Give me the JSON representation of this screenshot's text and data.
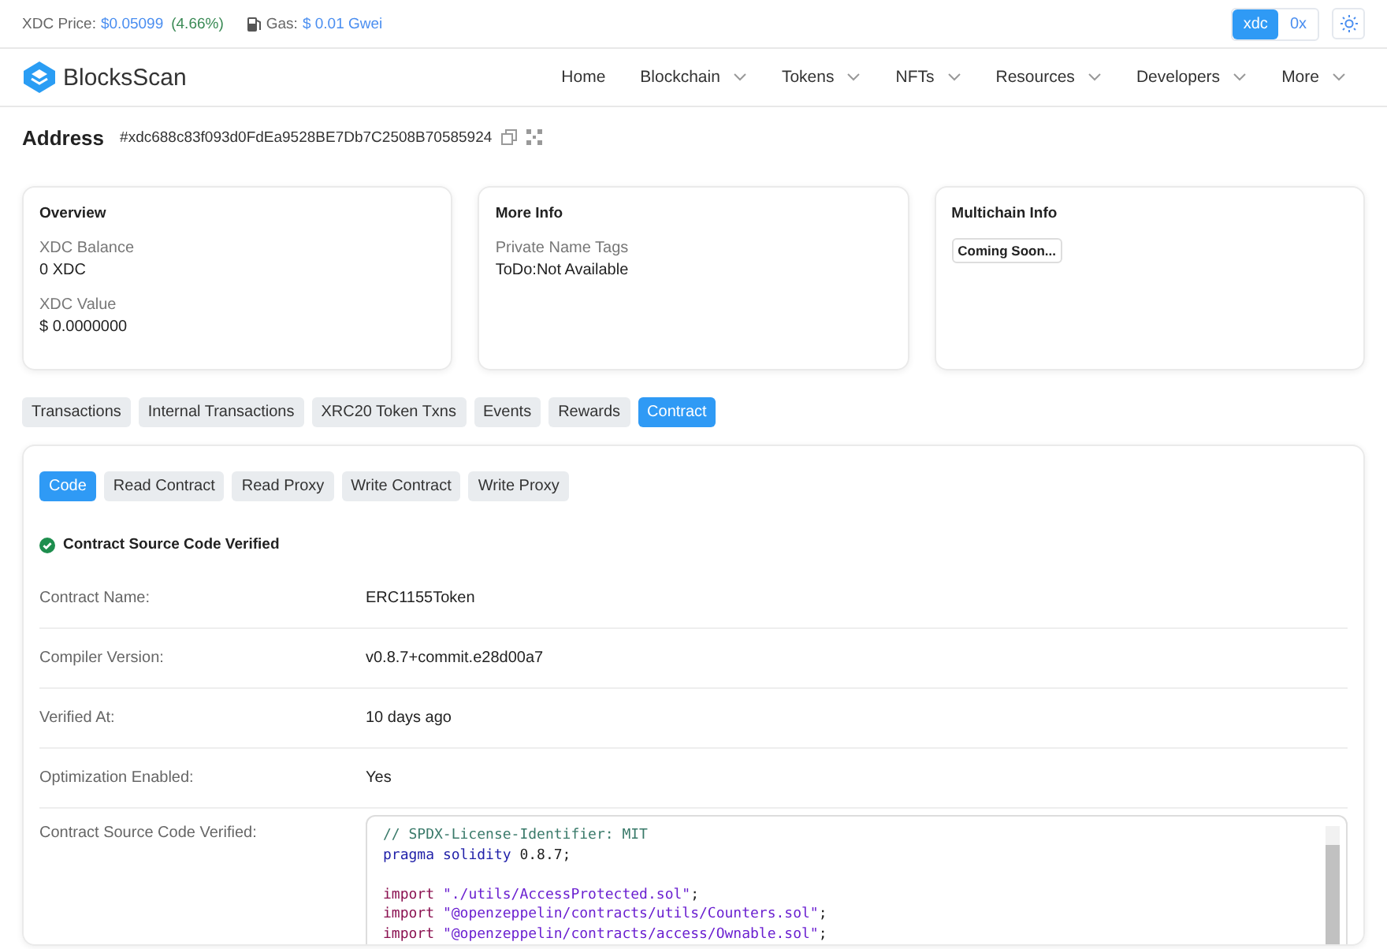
{
  "top_bar": {
    "price_label": "XDC Price:",
    "price": "$0.05099",
    "change": "(4.66%)",
    "gas_label": "Gas:",
    "gas": "$ 0.01 Gwei",
    "prefix_toggle": [
      {
        "label": "xdc",
        "selected": true
      },
      {
        "label": "0x",
        "selected": false
      }
    ]
  },
  "brand": "BlocksScan",
  "nav": [
    {
      "label": "Home",
      "dropdown": false
    },
    {
      "label": "Blockchain",
      "dropdown": true
    },
    {
      "label": "Tokens",
      "dropdown": true
    },
    {
      "label": "NFTs",
      "dropdown": true
    },
    {
      "label": "Resources",
      "dropdown": true
    },
    {
      "label": "Developers",
      "dropdown": true
    },
    {
      "label": "More",
      "dropdown": true
    }
  ],
  "address": {
    "title": "Address",
    "value": "#xdc688c83f093d0FdEa9528BE7Db7C2508B70585924"
  },
  "cards": [
    {
      "title": "Overview",
      "fields": [
        {
          "label": "XDC Balance",
          "value": "0 XDC"
        },
        {
          "label": "XDC Value",
          "value": "$ 0.0000000"
        }
      ]
    },
    {
      "title": "More Info",
      "fields": [
        {
          "label": "Private Name Tags",
          "value": "ToDo:Not Available"
        }
      ]
    },
    {
      "title": "Multichain Info",
      "badge": "Coming Soon..."
    }
  ],
  "tabs": [
    {
      "label": "Transactions",
      "selected": false
    },
    {
      "label": "Internal Transactions",
      "selected": false
    },
    {
      "label": "XRC20 Token Txns",
      "selected": false
    },
    {
      "label": "Events",
      "selected": false
    },
    {
      "label": "Rewards",
      "selected": false
    },
    {
      "label": "Contract",
      "selected": true
    }
  ],
  "contract": {
    "subtabs": [
      {
        "label": "Code",
        "selected": true
      },
      {
        "label": "Read Contract",
        "selected": false
      },
      {
        "label": "Read Proxy",
        "selected": false
      },
      {
        "label": "Write Contract",
        "selected": false
      },
      {
        "label": "Write Proxy",
        "selected": false
      }
    ],
    "verified": "Contract Source Code Verified",
    "rows": [
      {
        "label": "Contract Name:",
        "value": "ERC1155Token"
      },
      {
        "label": "Compiler Version:",
        "value": "v0.8.7+commit.e28d00a7"
      },
      {
        "label": "Verified At:",
        "value": "10 days ago"
      },
      {
        "label": "Optimization Enabled:",
        "value": "Yes"
      }
    ],
    "source_label": "Contract Source Code Verified:",
    "code": [
      {
        "blank_before": false,
        "tokens": [
          {
            "kind": "comment",
            "text": "// SPDX-License-Identifier: MIT"
          }
        ]
      },
      {
        "blank_before": false,
        "tokens": [
          {
            "kind": "keyword",
            "text": "pragma"
          },
          {
            "kind": "keyword",
            "text": "solidity"
          },
          {
            "kind": "plain",
            "text": "0.8.7;"
          }
        ]
      },
      {
        "blank_before": true,
        "tokens": [
          {
            "kind": "import",
            "text": "import"
          },
          {
            "kind": "string",
            "text": "\"./utils/AccessProtected.sol\""
          },
          {
            "kind": "punct",
            "text": ";"
          }
        ]
      },
      {
        "blank_before": false,
        "tokens": [
          {
            "kind": "import",
            "text": "import"
          },
          {
            "kind": "string",
            "text": "\"@openzeppelin/contracts/utils/Counters.sol\""
          },
          {
            "kind": "punct",
            "text": ";"
          }
        ]
      },
      {
        "blank_before": false,
        "tokens": [
          {
            "kind": "import",
            "text": "import"
          },
          {
            "kind": "string",
            "text": "\"@openzeppelin/contracts/access/Ownable.sol\""
          },
          {
            "kind": "punct",
            "text": ";"
          }
        ]
      }
    ]
  }
}
